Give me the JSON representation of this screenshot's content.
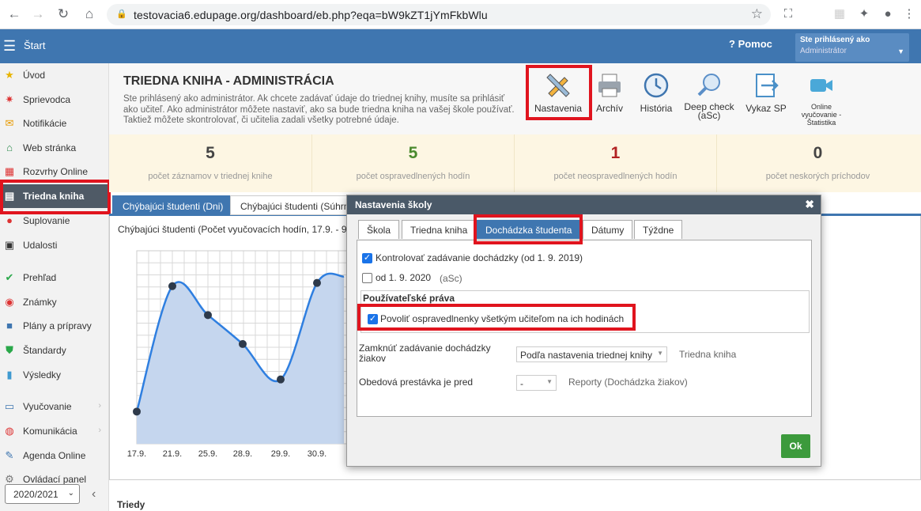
{
  "browser": {
    "url": "testovacia6.edupage.org/dashboard/eb.php?eqa=bW9kZT1jYmFkbWlu"
  },
  "topbar": {
    "menu": "Štart",
    "help": "Pomoc",
    "user_line1": "Ste prihlásený ako",
    "user_line2": "Administrátor"
  },
  "sidebar": {
    "items": [
      {
        "label": "Úvod",
        "icon": "star-icon"
      },
      {
        "label": "Sprievodca",
        "icon": "wand-icon"
      },
      {
        "label": "Notifikácie",
        "icon": "envelope-icon"
      },
      {
        "label": "Web stránka",
        "icon": "home-icon"
      },
      {
        "label": "Rozvrhy Online",
        "icon": "calendar-icon"
      },
      {
        "label": "Triedna kniha",
        "icon": "book-icon"
      },
      {
        "label": "Suplovanie",
        "icon": "person-icon"
      },
      {
        "label": "Udalosti",
        "icon": "calendar-events-icon"
      },
      {
        "label": "Prehľad",
        "icon": "check-icon"
      },
      {
        "label": "Známky",
        "icon": "grade-icon"
      },
      {
        "label": "Plány a prípravy",
        "icon": "briefcase-icon"
      },
      {
        "label": "Štandardy",
        "icon": "shield-icon"
      },
      {
        "label": "Výsledky",
        "icon": "bar-chart-icon"
      },
      {
        "label": "Vyučovanie",
        "icon": "book-open-icon"
      },
      {
        "label": "Komunikácia",
        "icon": "chat-icon"
      },
      {
        "label": "Agenda Online",
        "icon": "pen-icon"
      },
      {
        "label": "Ovládací panel",
        "icon": "gear-icon"
      }
    ],
    "year": "2020/2021"
  },
  "header": {
    "title": "TRIEDNA KNIHA - ADMINISTRÁCIA",
    "description": "Ste prihlásený ako administrátor. Ak chcete zadávať údaje do triednej knihy, musíte sa prihlásiť ako učiteľ. Ako administrátor môžete nastaviť, ako sa bude triedna kniha na vašej škole používať. Taktiež môžete skontrolovať, či učitelia zadali všetky potrebné údaje."
  },
  "tools": [
    {
      "label": "Nastavenia",
      "icon": "pencil-ruler-icon"
    },
    {
      "label": "Archív",
      "icon": "printer-icon"
    },
    {
      "label": "História",
      "icon": "clock-icon"
    },
    {
      "label": "Deep check\n(aSc)",
      "icon": "magnifier-icon"
    },
    {
      "label": "Vykaz SP",
      "icon": "export-icon"
    },
    {
      "label": "Online vyučovanie - Štatistika",
      "icon": "video-icon"
    }
  ],
  "stats": [
    {
      "value": "5",
      "label": "počet záznamov v triednej knihe",
      "color": "#444444"
    },
    {
      "value": "5",
      "label": "počet ospravedlnených hodín",
      "color": "#4a8a2e"
    },
    {
      "value": "1",
      "label": "počet neospravedlnených hodín",
      "color": "#b22222"
    },
    {
      "value": "0",
      "label": "počet neskorých príchodov",
      "color": "#444444"
    }
  ],
  "tabs": [
    "Chýbajúci študenti (Dni)",
    "Chýbajúci študenti (Súhrn"
  ],
  "chart_data": {
    "type": "area",
    "title": "Chýbajúci študenti (Počet vyučovacích hodín, 17.9. - 9",
    "categories": [
      "17.9.",
      "21.9.",
      "25.9.",
      "28.9.",
      "29.9.",
      "30.9."
    ],
    "values": [
      1.0,
      4.9,
      4.0,
      3.1,
      2.0,
      5.0,
      5.2
    ],
    "ylim": [
      0,
      6
    ]
  },
  "footer": {
    "section": "Triedy"
  },
  "modal": {
    "title": "Nastavenia školy",
    "tabs": [
      "Škola",
      "Triedna kniha",
      "Dochádzka študenta",
      "Dátumy",
      "Týždne"
    ],
    "active_tab": "Dochádzka študenta",
    "check1": "Kontrolovať zadávanie dochádzky (od 1. 9. 2019)",
    "check2": "od 1. 9. 2020",
    "check2_note": "(aSc)",
    "group_title": "Používateľské práva",
    "check3": "Povoliť ospravedlnenky všetkým učiteľom na ich hodinách",
    "lock_label": "Zamknúť zadávanie dochádzky\nžiakov",
    "lock_value": "Podľa nastavenia triednej knihy",
    "lock_note": "Triedna kniha",
    "lunch_label": "Obedová prestávka je pred",
    "lunch_value": "-",
    "lunch_note": "Reporty (Dochádzka žiakov)",
    "ok": "Ok"
  },
  "colors": {
    "accent": "#3f76b0",
    "highlight": "#e0141e",
    "ok": "#3c9a3c"
  }
}
